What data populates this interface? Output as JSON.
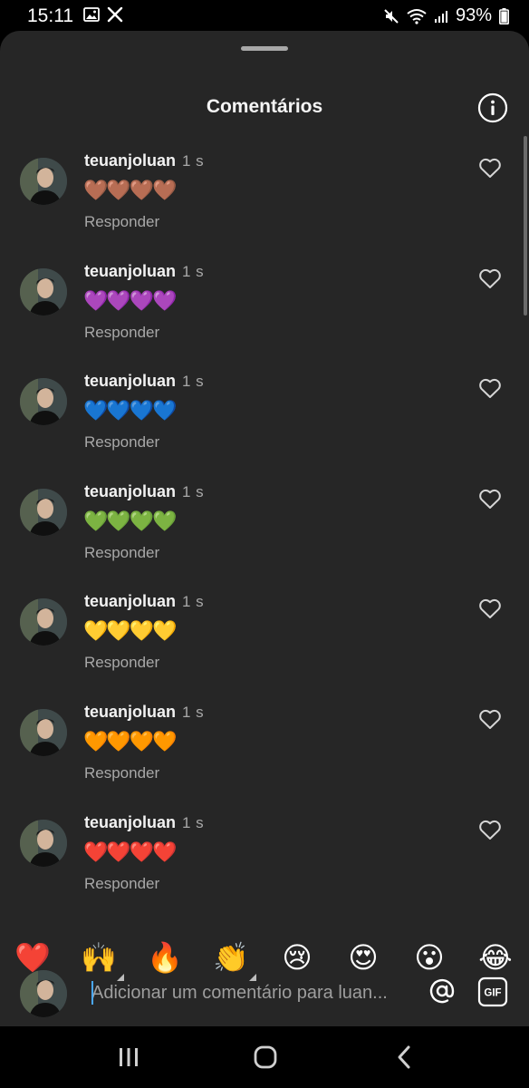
{
  "status_bar": {
    "time": "15:11",
    "battery": "93%"
  },
  "sheet": {
    "title": "Comentários"
  },
  "comments": [
    {
      "username": "teuanjoluan",
      "time": "1 s",
      "text": "🤎🤎🤎🤎",
      "reply_label": "Responder"
    },
    {
      "username": "teuanjoluan",
      "time": "1 s",
      "text": "💜💜💜💜",
      "reply_label": "Responder"
    },
    {
      "username": "teuanjoluan",
      "time": "1 s",
      "text": "💙💙💙💙",
      "reply_label": "Responder"
    },
    {
      "username": "teuanjoluan",
      "time": "1 s",
      "text": "💚💚💚💚",
      "reply_label": "Responder"
    },
    {
      "username": "teuanjoluan",
      "time": "1 s",
      "text": "💛💛💛💛",
      "reply_label": "Responder"
    },
    {
      "username": "teuanjoluan",
      "time": "1 s",
      "text": "🧡🧡🧡🧡",
      "reply_label": "Responder"
    },
    {
      "username": "teuanjoluan",
      "time": "1 s",
      "text": "❤️❤️❤️❤️",
      "reply_label": "Responder"
    }
  ],
  "emoji_bar": [
    "❤️",
    "🙌",
    "🔥",
    "👏",
    "😢",
    "😍",
    "😮",
    "😂"
  ],
  "input": {
    "placeholder": "Adicionar um comentário para luan..."
  },
  "colors": {
    "sheet_bg": "#262626",
    "text_secondary": "#a8a8a8",
    "caret": "#4aa8ff"
  }
}
